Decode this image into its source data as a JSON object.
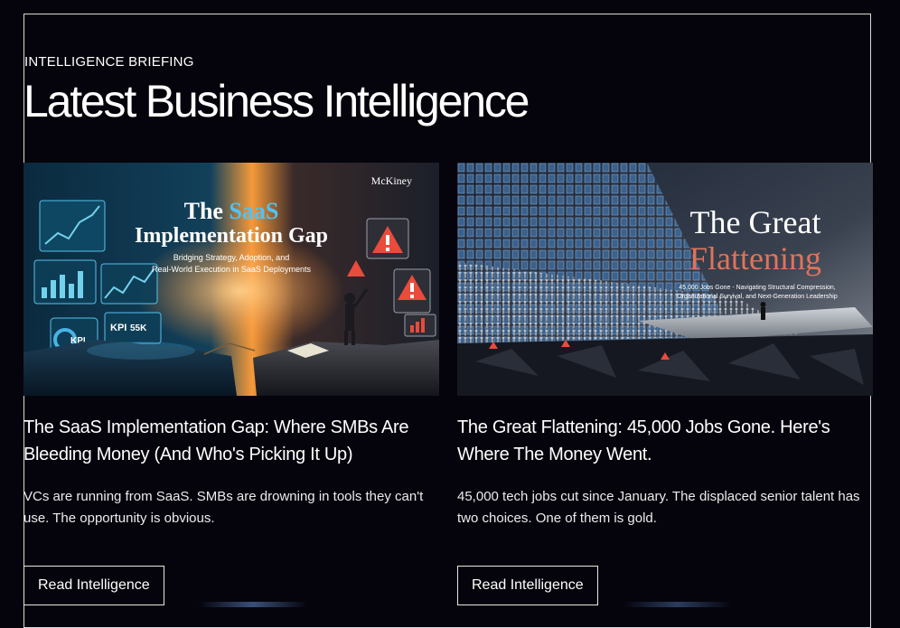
{
  "section": {
    "eyebrow": "INTELLIGENCE BRIEFING",
    "title": "Latest Business Intelligence"
  },
  "cards": [
    {
      "image": {
        "brand": "McKiney",
        "headline_part1": "The ",
        "headline_accent": "SaaS",
        "headline_part2": "Implementation Gap",
        "subtitle_line1": "Bridging Strategy, Adoption, and",
        "subtitle_line2": "Real-World Execution in SaaS Deployments",
        "accent_color": "#4fc3f7",
        "kpi_label": "KPI",
        "kpi_value": "55K"
      },
      "title": "The SaaS Implementation Gap: Where SMBs Are Bleeding Money (And Who's Picking It Up)",
      "description": "VCs are running from SaaS. SMBs are drowning in tools they can't use. The opportunity is obvious.",
      "button_label": "Read Intelligence"
    },
    {
      "image": {
        "headline_line1": "The Great",
        "headline_line2": "Flattening",
        "accent_color": "#e0735a",
        "subtitle_line1": "45,000 Jobs Gone - Navigating Structural Compression,",
        "subtitle_line2": "Organizational Survival, and Next-Generation Leadership"
      },
      "title": "The Great Flattening: 45,000 Jobs Gone. Here's Where The Money Went.",
      "description": "45,000 tech jobs cut since January. The displaced senior talent has two choices. One of them is gold.",
      "button_label": "Read Intelligence"
    }
  ]
}
